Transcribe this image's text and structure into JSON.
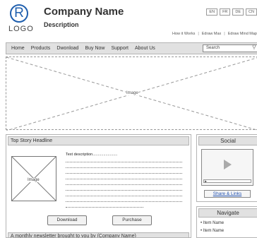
{
  "header": {
    "logo_letter": "R",
    "logo_text": "LOGO",
    "company_name": "Company Name",
    "description": "Description",
    "languages": [
      "EN",
      "FR",
      "DE",
      "CN"
    ],
    "top_links": [
      "How it Works",
      "Edraw Max",
      "Edraw Mind Map"
    ]
  },
  "nav": {
    "items": [
      "Home",
      "Products",
      "Dwonload",
      "Buy Now",
      "Support",
      "About Us"
    ],
    "search_value": "Search"
  },
  "hero": {
    "label": "Image"
  },
  "story": {
    "headline": "Top Story Headline",
    "image_label": "Image",
    "text_description": "Text description.......................",
    "download_label": "Download",
    "purchase_label": "Purchase",
    "newsletter": "A monthly newsletter brought to you by (Company Name)"
  },
  "social": {
    "title": "Social",
    "share_label": "Share & Links"
  },
  "navigate": {
    "title": "Navigate",
    "items": [
      "Item Name",
      "Item Name"
    ]
  }
}
